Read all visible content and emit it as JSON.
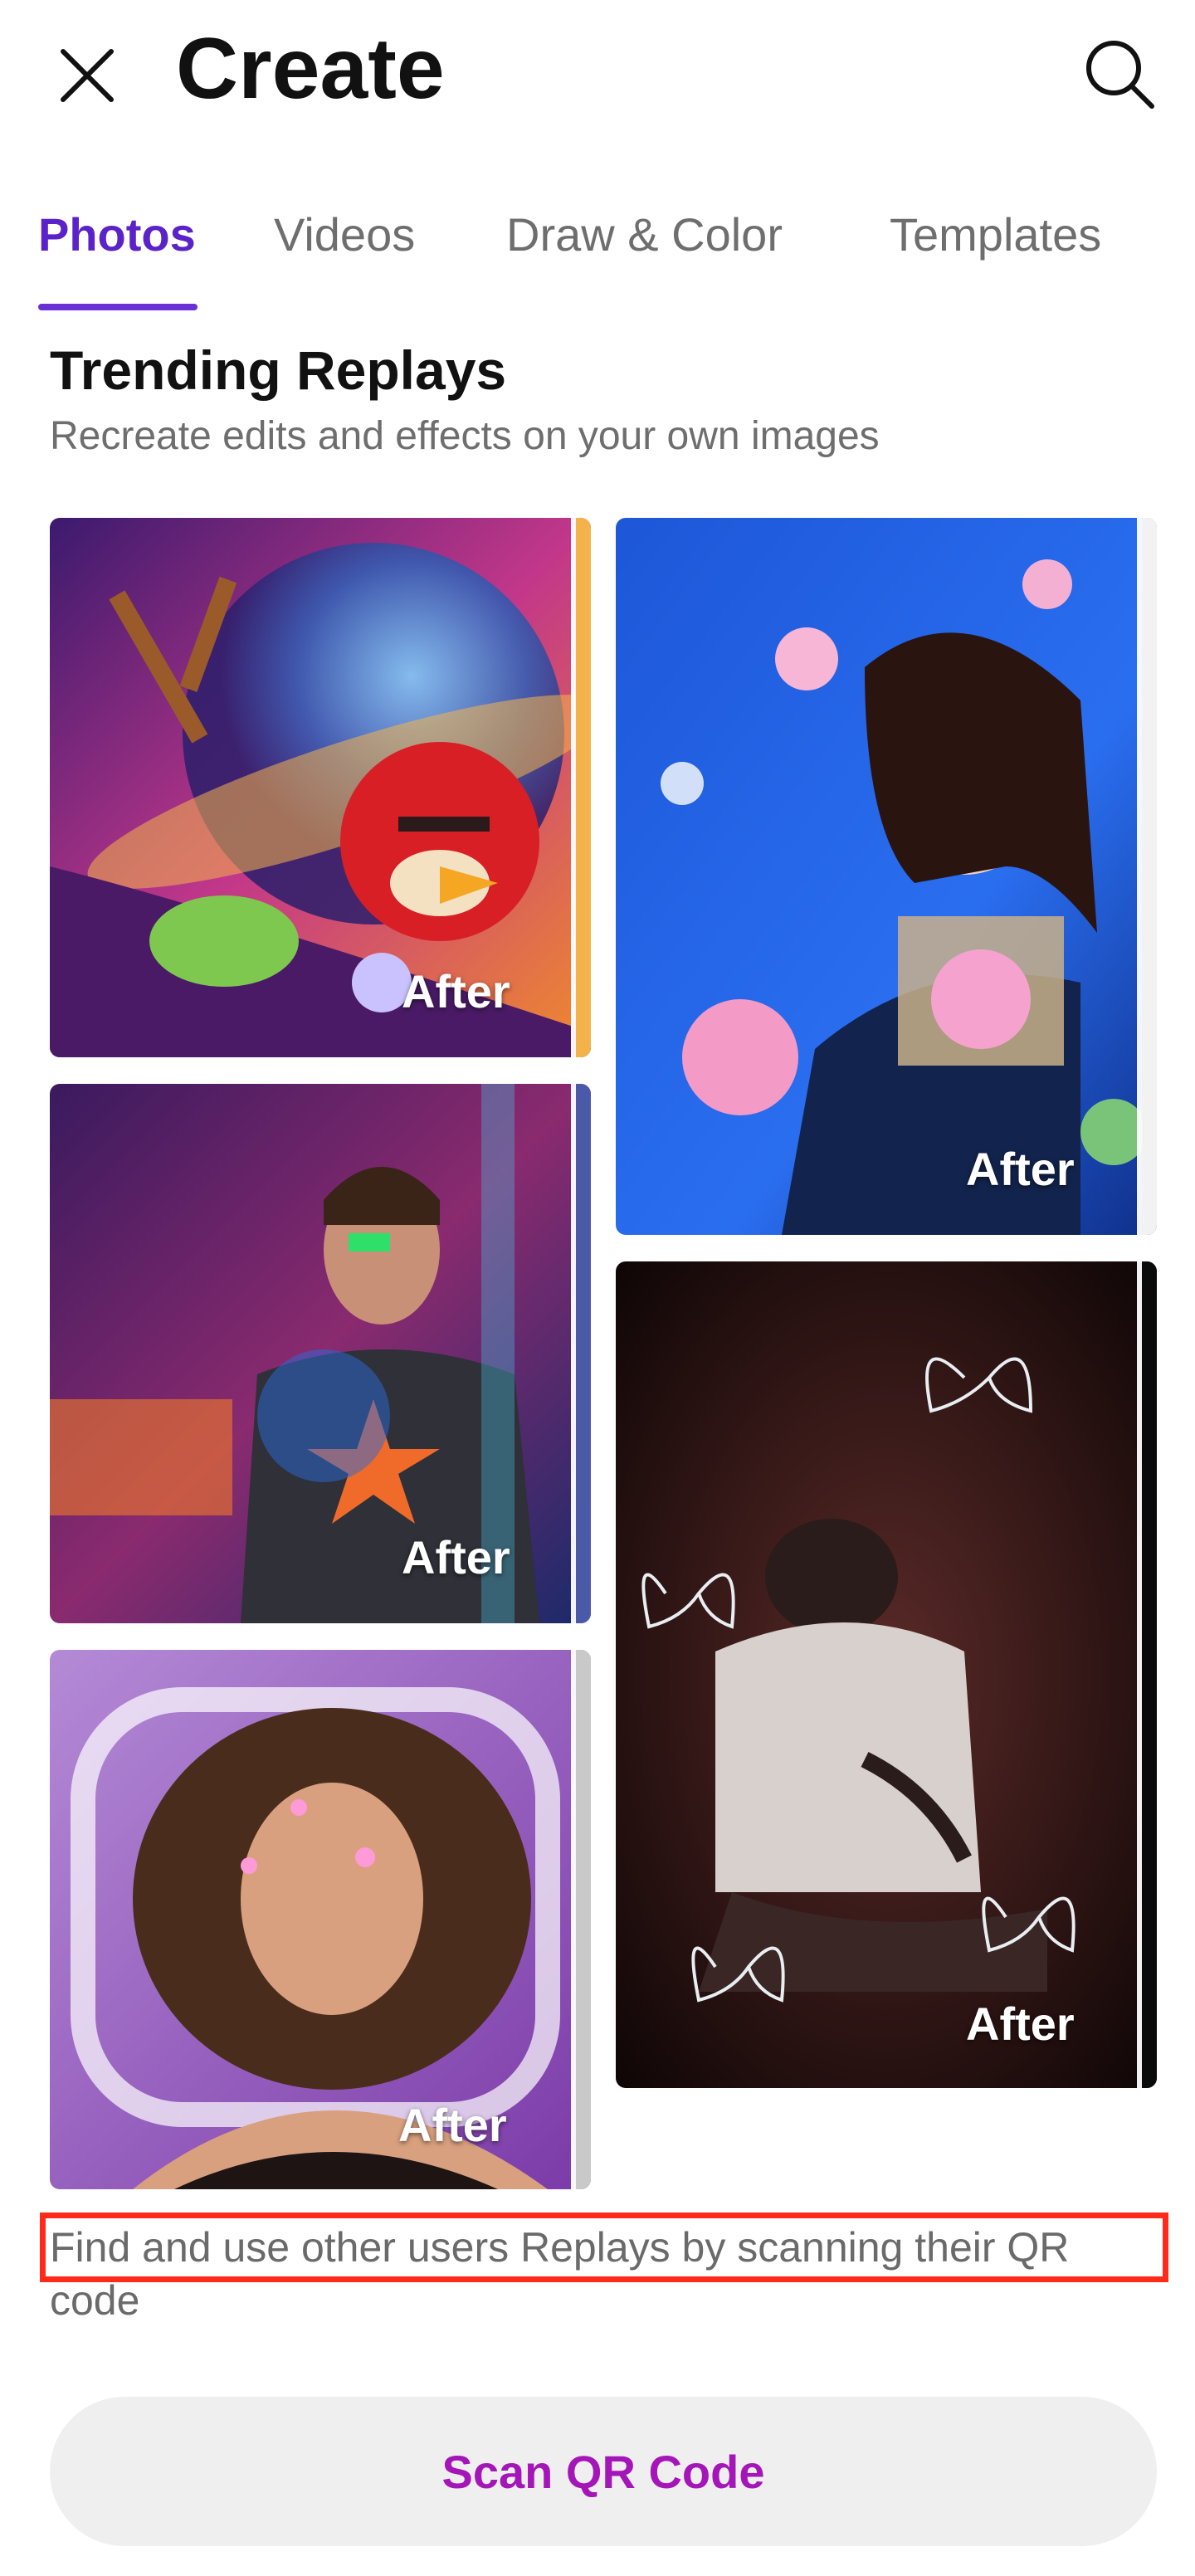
{
  "header": {
    "title": "Create",
    "close_icon": "close-icon",
    "search_icon": "search-icon"
  },
  "tabs": [
    {
      "label": "Photos",
      "active": true
    },
    {
      "label": "Videos",
      "active": false
    },
    {
      "label": "Draw & Color",
      "active": false
    },
    {
      "label": "Templates",
      "active": false
    }
  ],
  "section": {
    "title": "Trending Replays",
    "subtitle": "Recreate edits and effects on your own images"
  },
  "cards": [
    {
      "label": "After"
    },
    {
      "label": "After"
    },
    {
      "label": "After"
    },
    {
      "label": "After"
    },
    {
      "label": "After"
    }
  ],
  "footer": {
    "qr_text": "Find and use other users Replays by scanning their QR code",
    "scan_button": "Scan QR Code"
  },
  "colors": {
    "accent": "#5b22c9",
    "scan_text": "#a516b8",
    "highlight": "#ff2a1a"
  }
}
